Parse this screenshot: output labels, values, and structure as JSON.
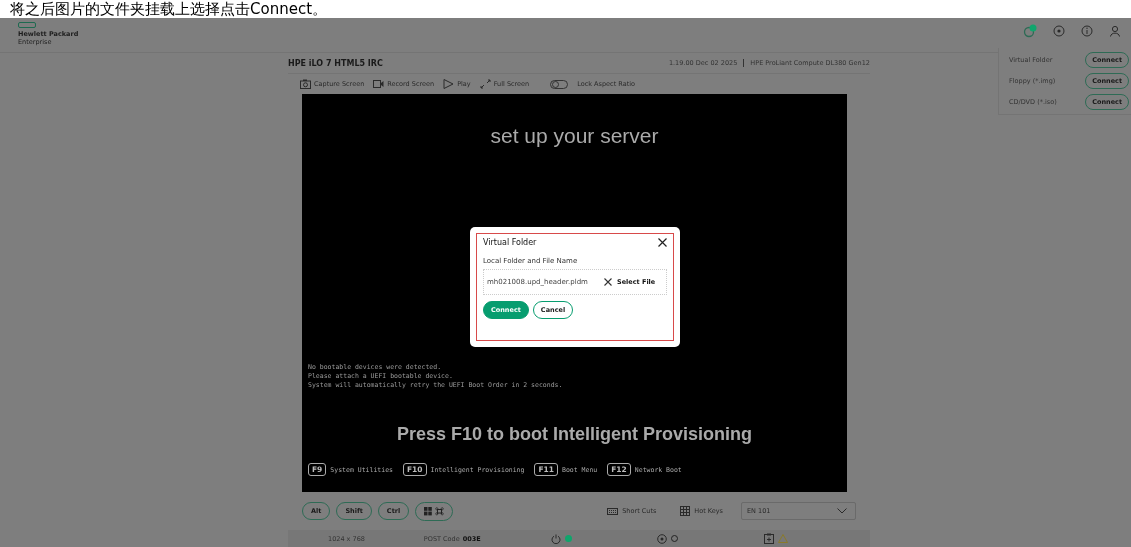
{
  "caption": "将之后图片的文件夹挂载上选择点击Connect。",
  "header": {
    "brand_line1": "Hewlett Packard",
    "brand_line2": "Enterprise"
  },
  "app_title": "HPE iLO 7 HTML5 IRC",
  "firmware": "1.19.00 Dec 02 2025",
  "server_model": "HPE ProLiant Compute DL380 Gen12",
  "toolbar": [
    {
      "kind": "camera",
      "label": "Capture Screen"
    },
    {
      "kind": "record",
      "label": "Record Screen"
    },
    {
      "kind": "play",
      "label": "Play"
    },
    {
      "kind": "expand",
      "label": "Full Screen"
    }
  ],
  "lock_aspect_ratio": {
    "label": "Lock Aspect Ratio",
    "on": false
  },
  "console": {
    "heading": "set up your server",
    "messages": [
      "No bootable devices were detected.",
      "Please attach a UEFI bootable device.",
      "System will automatically retry the UEFI Boot Order in 2 seconds."
    ],
    "prompt": "Press F10 to boot Intelligent Provisioning",
    "fkeys": [
      {
        "key": "F9",
        "label": "System Utilities"
      },
      {
        "key": "F10",
        "label": "Intelligent Provisioning"
      },
      {
        "key": "F11",
        "label": "Boot Menu"
      },
      {
        "key": "F12",
        "label": "Network Boot"
      }
    ]
  },
  "dialog": {
    "title": "Virtual Folder",
    "field_label": "Local Folder and File Name",
    "value": "mh021008.upd_header.pldm",
    "select_label": "Select File",
    "buttons": [
      {
        "kind": "primary",
        "label": "Connect"
      },
      {
        "kind": "secondary",
        "label": "Cancel"
      }
    ]
  },
  "keys": [
    "Alt",
    "Shift",
    "Ctrl"
  ],
  "shortcuts": {
    "short_cuts": "Short Cuts",
    "hot_keys": "Hot Keys",
    "layout": "EN 101"
  },
  "status": {
    "resolution": "1024 x 768",
    "post_label": "POST Code",
    "post_code": "003E",
    "power_on": true,
    "uid_on": false
  },
  "media": [
    {
      "label": "Virtual Folder",
      "button": "Connect"
    },
    {
      "label": "Floppy (*.img)",
      "button": "Connect"
    },
    {
      "label": "CD/DVD (*.iso)",
      "button": "Connect"
    }
  ]
}
